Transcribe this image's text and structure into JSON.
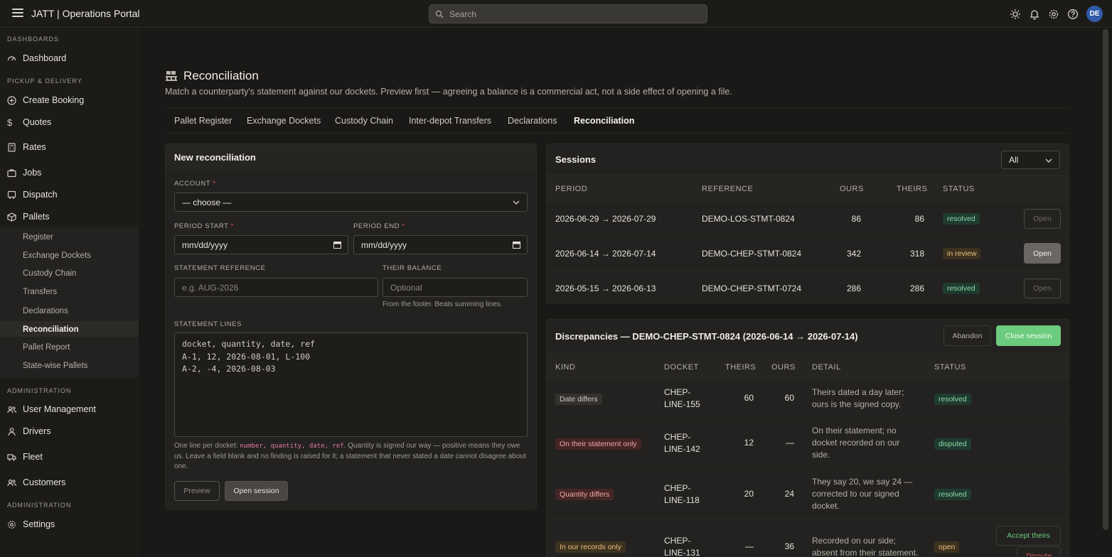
{
  "app": {
    "title": "JATT | Operations Portal",
    "avatar_initials": "DE",
    "search_placeholder": "Search"
  },
  "sidebar": {
    "sections": [
      {
        "label": "DASHBOARDS"
      },
      {
        "label": "PICKUP & DELIVERY"
      },
      {
        "label": "ADMINISTRATION"
      },
      {
        "label": "ADMINISTRATION"
      }
    ],
    "items": {
      "dashboard": "Dashboard",
      "create_booking": "Create Booking",
      "quotes": "Quotes",
      "rates": "Rates",
      "jobs": "Jobs",
      "dispatch": "Dispatch",
      "pallets": "Pallets",
      "user_management": "User Management",
      "drivers": "Drivers",
      "fleet": "Fleet",
      "customers": "Customers",
      "settings": "Settings"
    },
    "pallet_sub": [
      "Register",
      "Exchange Dockets",
      "Custody Chain",
      "Transfers",
      "Declarations",
      "Reconciliation",
      "Pallet Report",
      "State-wise Pallets"
    ]
  },
  "page": {
    "title": "Reconciliation",
    "subtitle": "Match a counterparty's statement against our dockets. Preview first — agreeing a balance is a commercial act, not a side effect of opening a file.",
    "tabs": [
      "Pallet Register",
      "Exchange Dockets",
      "Custody Chain",
      "Inter-depot Transfers",
      "Declarations",
      "Reconciliation"
    ],
    "active_tab": "Reconciliation"
  },
  "new_recon": {
    "heading": "New reconciliation",
    "account_label": "ACCOUNT",
    "account_value": "— choose —",
    "period_start_label": "PERIOD START",
    "period_start_value": "mm/dd/yyyy",
    "period_end_label": "PERIOD END",
    "period_end_value": "mm/dd/yyyy",
    "stmt_ref_label": "STATEMENT REFERENCE",
    "stmt_ref_placeholder": "e.g. AUG-2026",
    "balance_label": "THEIR BALANCE",
    "balance_placeholder": "Optional",
    "balance_hint": "From the footer. Beats summing lines.",
    "lines_label": "STATEMENT LINES",
    "lines_value": "docket, quantity, date, ref\nA-1, 12, 2026-08-01, L-100\nA-2, -4, 2026-08-03",
    "help_pre": "One line per docket: ",
    "help_code": "number, quantity, date, ref",
    "help_post": ". Quantity is signed our way — positive means they owe us. Leave a field blank and no finding is raised for it; a statement that never stated a date cannot disagree about one.",
    "preview_btn": "Preview",
    "open_btn": "Open session"
  },
  "sessions": {
    "heading": "Sessions",
    "filter_value": "All",
    "columns": [
      "PERIOD",
      "REFERENCE",
      "OURS",
      "THEIRS",
      "STATUS"
    ],
    "rows": [
      {
        "period": "2026-06-29 → 2026-07-29",
        "reference": "DEMO-LOS-STMT-0824",
        "ours": "86",
        "theirs": "86",
        "status": "resolved",
        "action": "Open"
      },
      {
        "period": "2026-06-14 → 2026-07-14",
        "reference": "DEMO-CHEP-STMT-0824",
        "ours": "342",
        "theirs": "318",
        "status": "in review",
        "action": "Open"
      },
      {
        "period": "2026-05-15 → 2026-06-13",
        "reference": "DEMO-CHEP-STMT-0724",
        "ours": "286",
        "theirs": "286",
        "status": "resolved",
        "action": "Open"
      }
    ]
  },
  "discrepancies": {
    "heading": "Discrepancies — DEMO-CHEP-STMT-0824 (2026-06-14 → 2026-07-14)",
    "abandon_btn": "Abandon",
    "close_btn": "Close session",
    "columns": [
      "KIND",
      "DOCKET",
      "THEIRS",
      "OURS",
      "DETAIL",
      "STATUS"
    ],
    "rows": [
      {
        "kind": "Date differs",
        "docket_l1": "CHEP-",
        "docket_l2": "LINE-155",
        "theirs": "60",
        "ours": "60",
        "detail_l1": "Theirs dated a day later;",
        "detail_l2": "ours is the signed copy.",
        "detail_l3": "",
        "status": "resolved"
      },
      {
        "kind": "On their statement only",
        "docket_l1": "CHEP-",
        "docket_l2": "LINE-142",
        "theirs": "12",
        "ours": "—",
        "detail_l1": "On their statement; no",
        "detail_l2": "docket recorded on our",
        "detail_l3": "side.",
        "status": "disputed"
      },
      {
        "kind": "Quantity differs",
        "docket_l1": "CHEP-",
        "docket_l2": "LINE-118",
        "theirs": "20",
        "ours": "24",
        "detail_l1": "They say 20, we say 24 —",
        "detail_l2": "corrected to our signed",
        "detail_l3": "docket.",
        "status": "resolved"
      },
      {
        "kind": "In our records only",
        "docket_l1": "CHEP-",
        "docket_l2": "LINE-131",
        "theirs": "—",
        "ours": "36",
        "detail_l1": "Recorded on our side;",
        "detail_l2": "absent from their statement.",
        "detail_l3": "",
        "status": "open",
        "accept_btn": "Accept theirs",
        "dispute_btn": "Dispute"
      }
    ]
  }
}
